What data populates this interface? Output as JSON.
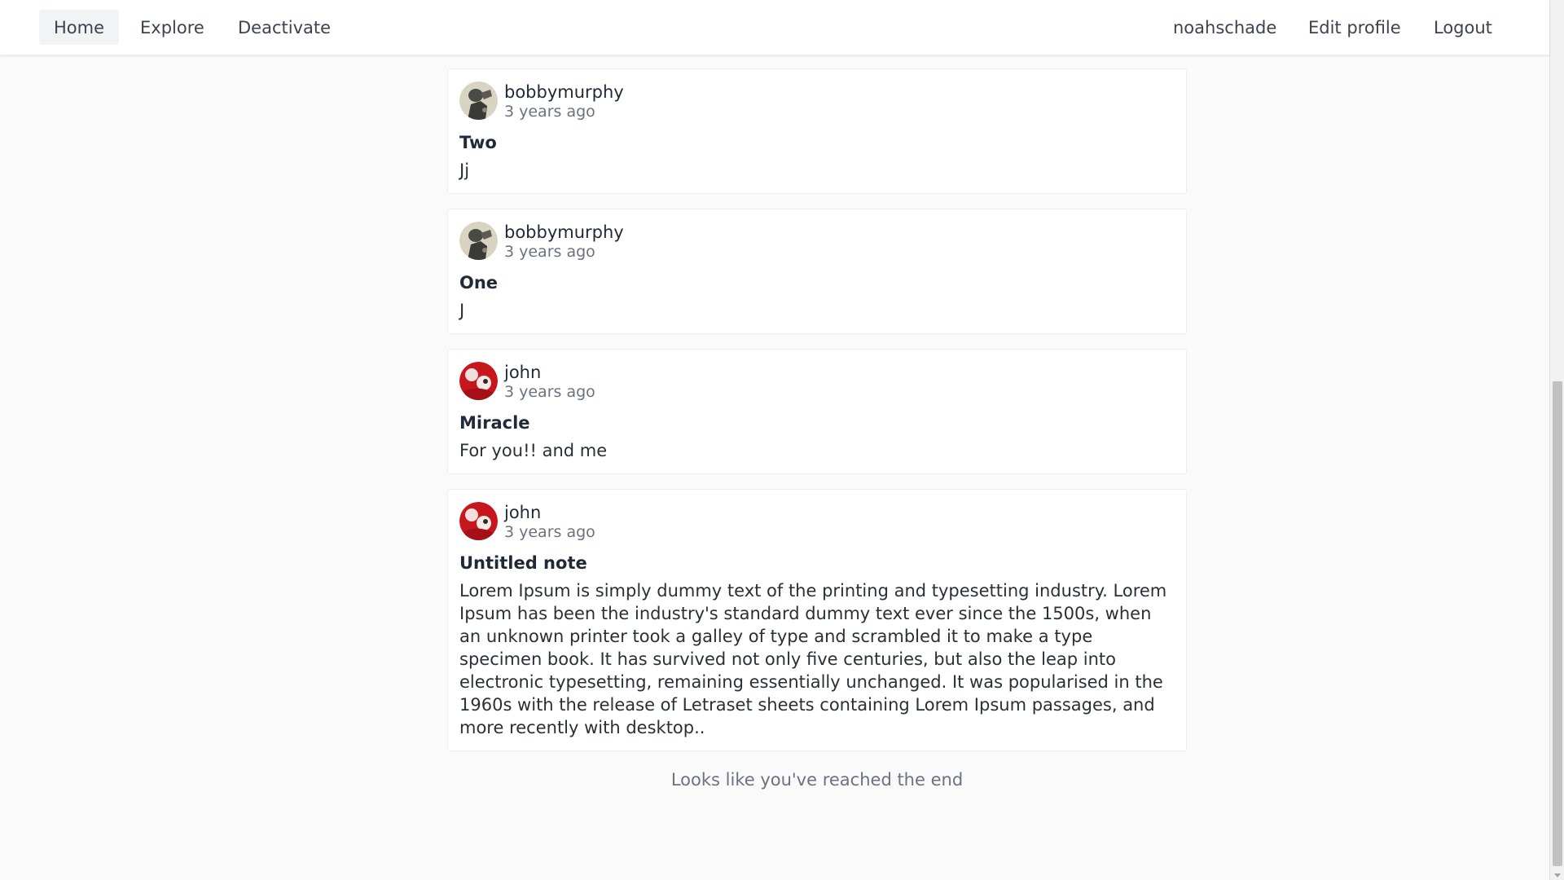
{
  "nav": {
    "left": [
      {
        "label": "Home",
        "active": true
      },
      {
        "label": "Explore",
        "active": false
      },
      {
        "label": "Deactivate",
        "active": false
      }
    ],
    "right": [
      {
        "label": "noahschade"
      },
      {
        "label": "Edit profile"
      },
      {
        "label": "Logout"
      }
    ]
  },
  "notes": [
    {
      "username": "bobbymurphy",
      "time": "3 years ago",
      "title": "Two",
      "body": "Jj",
      "avatar": "bobby-avatar-icon"
    },
    {
      "username": "bobbymurphy",
      "time": "3 years ago",
      "title": "One",
      "body": "J",
      "avatar": "bobby-avatar-icon"
    },
    {
      "username": "john",
      "time": "3 years ago",
      "title": "Miracle",
      "body": "For you!! and me",
      "avatar": "john-avatar-icon"
    },
    {
      "username": "john",
      "time": "3 years ago",
      "title": "Untitled note",
      "body": "Lorem Ipsum is simply dummy text of the printing and typesetting industry. Lorem Ipsum has been the industry's standard dummy text ever since the 1500s, when an unknown printer took a galley of type and scrambled it to make a type specimen book. It has survived not only five centuries, but also the leap into electronic typesetting, remaining essentially unchanged. It was popularised in the 1960s with the release of Letraset sheets containing Lorem Ipsum passages, and more recently with desktop..",
      "avatar": "john-avatar-icon"
    }
  ],
  "feed_end": "Looks like you've reached the end",
  "colors": {
    "background": "#fafafa",
    "card": "#ffffff",
    "muted_text": "#6b7280",
    "active_nav_bg": "#f1f3f5"
  }
}
